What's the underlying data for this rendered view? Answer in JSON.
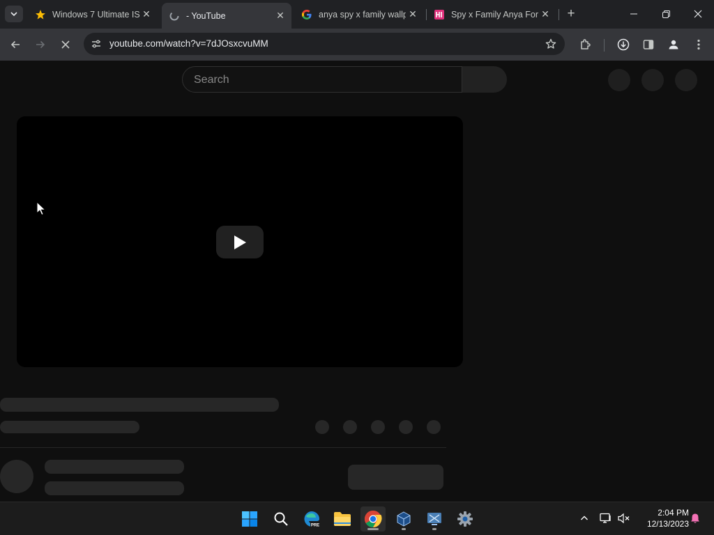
{
  "browser": {
    "tabs": [
      {
        "title": "Windows 7 Ultimate IS",
        "favicon": "star-favicon",
        "active": false
      },
      {
        "title": "- YouTube",
        "favicon": "loading-favicon",
        "active": true
      },
      {
        "title": "anya spy x family wallp",
        "favicon": "google-favicon",
        "active": false
      },
      {
        "title": "Spy x Family Anya Forg",
        "favicon": "pink-site-favicon",
        "active": false
      }
    ],
    "url": "youtube.com/watch?v=7dJOsxcvuMM"
  },
  "youtube": {
    "search_placeholder": "Search"
  },
  "taskbar": {
    "time": "2:04 PM",
    "date": "12/13/2023"
  },
  "colors": {
    "tab_bar": "#202124",
    "toolbar": "#35363a",
    "page_bg": "#0f0f0f",
    "skeleton": "#272727",
    "notification_bell": "#f472b6"
  }
}
